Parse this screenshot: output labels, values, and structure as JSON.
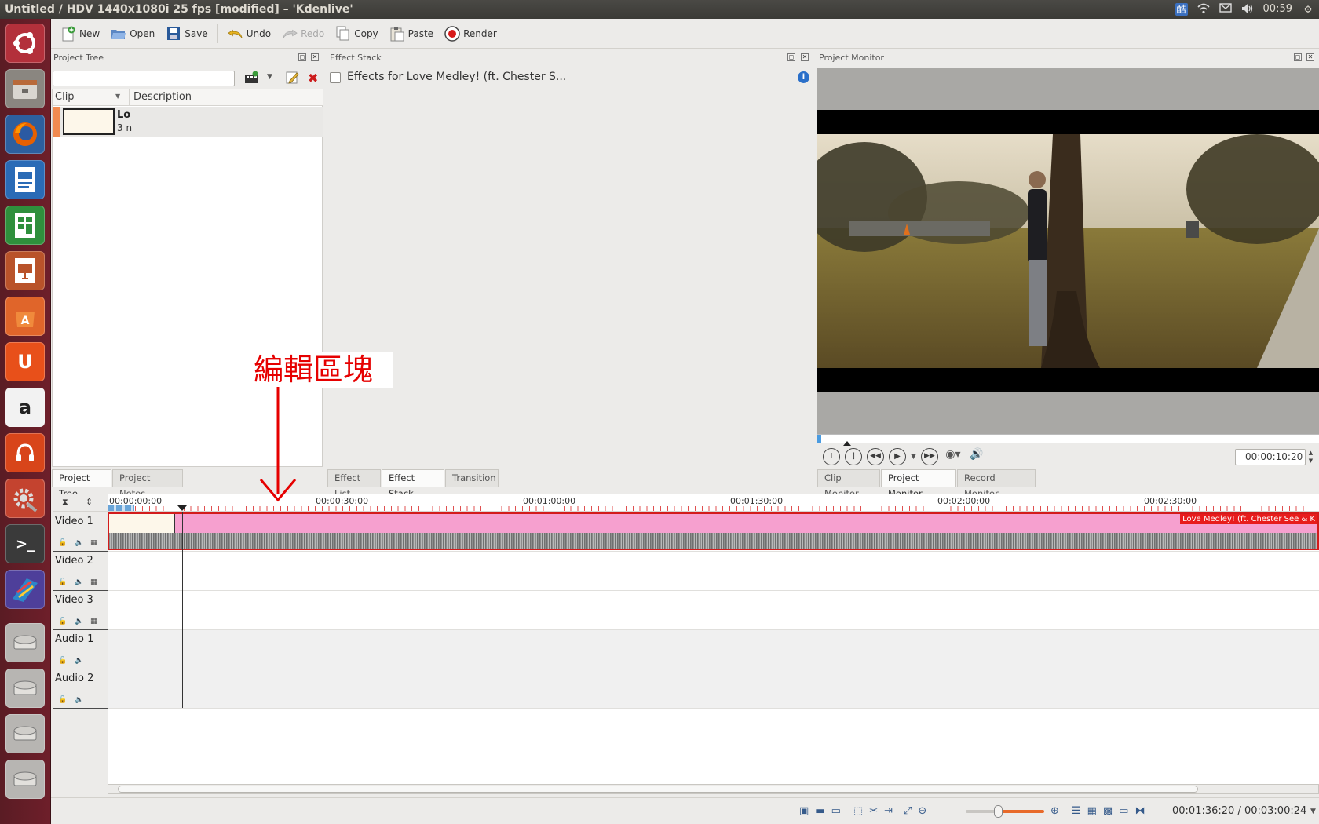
{
  "window": {
    "title": "Untitled / HDV 1440x1080i 25 fps [modified] – 'Kdenlive'"
  },
  "topbar": {
    "ime": "酷",
    "time": "00:59"
  },
  "toolbar": {
    "new_label": "New",
    "open_label": "Open",
    "save_label": "Save",
    "undo_label": "Undo",
    "redo_label": "Redo",
    "copy_label": "Copy",
    "paste_label": "Paste",
    "render_label": "Render"
  },
  "project_tree": {
    "title": "Project Tree",
    "columns": [
      "Clip",
      "Description"
    ],
    "clip": {
      "name": "Lo",
      "duration": "3 n"
    },
    "tabs": [
      "Project Tree",
      "Project Notes"
    ]
  },
  "effect_stack": {
    "title": "Effect Stack",
    "header": "Effects for Love Medley! (ft. Chester S...",
    "tabs": [
      "Effect List",
      "Effect Stack",
      "Transition"
    ]
  },
  "project_monitor": {
    "title": "Project Monitor",
    "timecode": "00:00:10:20",
    "tabs": [
      "Clip Monitor",
      "Project Monitor",
      "Record Monitor"
    ]
  },
  "annotation": {
    "text": "編輯區塊",
    "color": "#e60000"
  },
  "timeline": {
    "ruler_labels": [
      "00:00:00:00",
      "00:00:30:00",
      "00:01:00:00",
      "00:01:30:00",
      "00:02:00:00",
      "00:02:30:00"
    ],
    "tracks": [
      "Video 1",
      "Video 2",
      "Video 3",
      "Audio 1",
      "Audio 2"
    ],
    "clip_label": "Love Medley! (ft. Chester See & K",
    "clip_color": "#f6a0cf"
  },
  "status": {
    "position": "00:01:36:20 / 00:03:00:24"
  }
}
